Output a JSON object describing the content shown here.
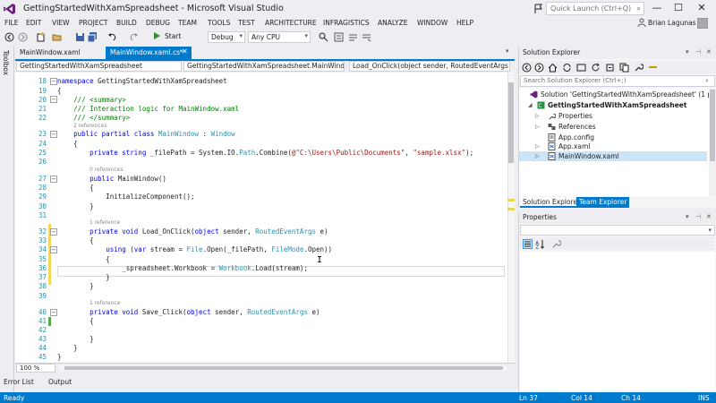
{
  "window": {
    "title": "GettingStartedWithXamSpreadsheet - Microsoft Visual Studio",
    "quick_launch_placeholder": "Quick Launch (Ctrl+Q)",
    "minimize": "—",
    "maximize": "☐",
    "close": "✕"
  },
  "menu": {
    "items": [
      "FILE",
      "EDIT",
      "VIEW",
      "PROJECT",
      "BUILD",
      "DEBUG",
      "TEAM",
      "TOOLS",
      "TEST",
      "ARCHITECTURE",
      "INFRAGISTICS",
      "ANALYZE",
      "WINDOW",
      "HELP"
    ],
    "user_name": "Brian Lagunas"
  },
  "toolbar": {
    "start_label": "Start",
    "config": "Debug",
    "platform": "Any CPU"
  },
  "toolbox_label": "Toolbox",
  "tabs": {
    "tab1": "MainWindow.xaml",
    "tab2": "MainWindow.xaml.cs*",
    "close": "✕"
  },
  "navbar": {
    "project": "GettingStartedWithXamSpreadsheet",
    "class": "GettingStartedWithXamSpreadsheet.MainWindow",
    "member": "Load_OnClick(object sender, RoutedEventArgs e)"
  },
  "code": {
    "line_numbers": [
      "18",
      "19",
      "20",
      "21",
      "22",
      "23",
      "24",
      "25",
      "26",
      "27",
      "28",
      "29",
      "30",
      "31",
      "32",
      "33",
      "34",
      "35",
      "36",
      "37",
      "38",
      "39",
      "40",
      "41",
      "42",
      "43",
      "44",
      "45"
    ],
    "refs": {
      "class": "2 references",
      "ctor": "0 references",
      "load": "1 reference",
      "save": "1 reference"
    }
  },
  "editor": {
    "zoom": "100 %"
  },
  "bottom_tabs": [
    "Error List",
    "Output"
  ],
  "status": {
    "state": "Ready",
    "ln": "Ln 37",
    "col": "Col 14",
    "ch": "Ch 14",
    "mode": "INS"
  },
  "solution_explorer": {
    "title": "Solution Explorer",
    "search_placeholder": "Search Solution Explorer (Ctrl+;)",
    "solution": "Solution 'GettingStartedWithXamSpreadsheet' (1 project)",
    "project": "GettingStartedWithXamSpreadsheet",
    "items": [
      "Properties",
      "References",
      "App.config",
      "App.xaml",
      "MainWindow.xaml"
    ],
    "tab1": "Solution Explorer",
    "tab2": "Team Explorer"
  },
  "properties": {
    "title": "Properties"
  },
  "colors": {
    "accent": "#007acc",
    "keyword": "#0000ff",
    "type": "#2b91af",
    "comment": "#008000",
    "string": "#a31515"
  }
}
